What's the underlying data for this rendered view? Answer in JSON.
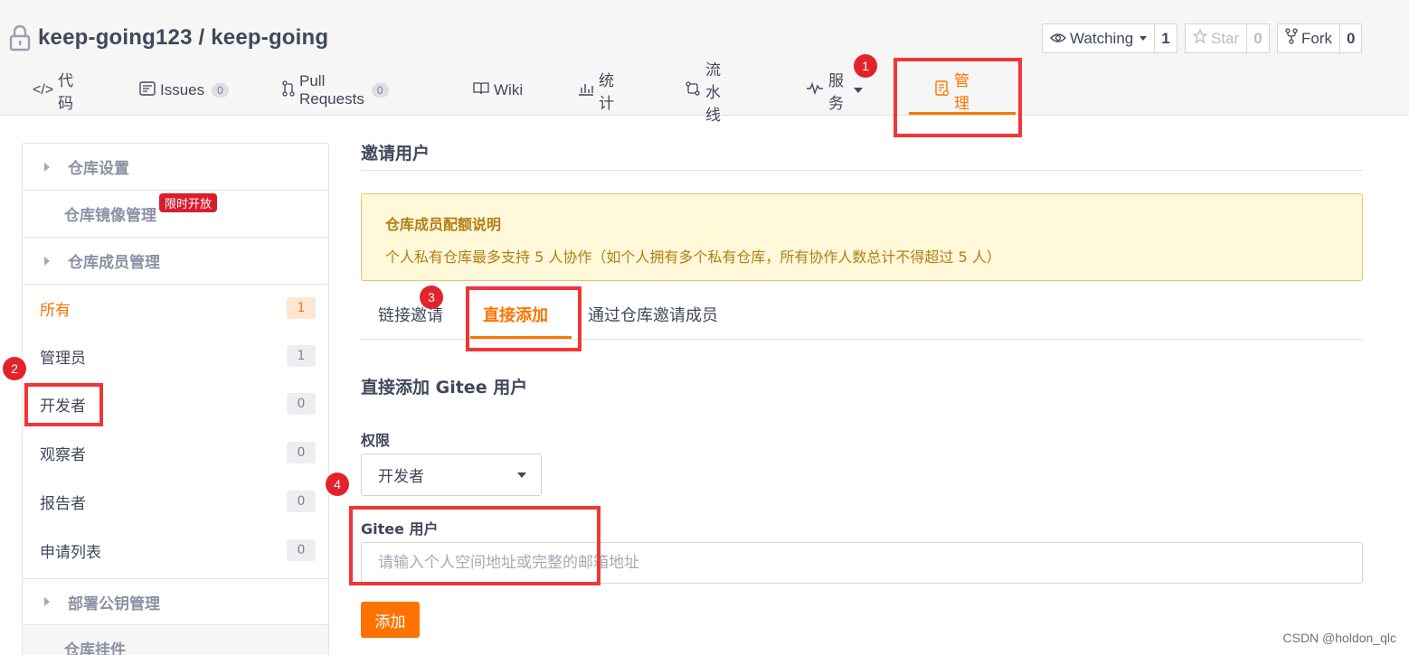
{
  "repo": {
    "title": "keep-going123 / keep-going"
  },
  "header_buttons": {
    "watching": {
      "label": "Watching",
      "count": "1"
    },
    "star": {
      "label": "Star",
      "count": "0"
    },
    "fork": {
      "label": "Fork",
      "count": "0"
    }
  },
  "tabs": [
    {
      "label": "代码"
    },
    {
      "label": "Issues",
      "badge": "0"
    },
    {
      "label": "Pull Requests",
      "badge": "0"
    },
    {
      "label": "Wiki"
    },
    {
      "label": "统计"
    },
    {
      "label": "流水线"
    },
    {
      "label": "服务"
    },
    {
      "label": "管理"
    }
  ],
  "markers": [
    "1",
    "2",
    "3",
    "4"
  ],
  "sidebar": {
    "sections": {
      "repo_settings": "仓库设置",
      "mirror": "仓库镜像管理",
      "mirror_tag": "限时开放",
      "members": "仓库成员管理",
      "deploy_keys": "部署公钥管理",
      "plugins": "仓库挂件"
    },
    "items": [
      {
        "label": "所有",
        "count": "1"
      },
      {
        "label": "管理员",
        "count": "1"
      },
      {
        "label": "开发者",
        "count": "0"
      },
      {
        "label": "观察者",
        "count": "0"
      },
      {
        "label": "报告者",
        "count": "0"
      },
      {
        "label": "申请列表",
        "count": "0"
      }
    ]
  },
  "main": {
    "title": "邀请用户",
    "notice": {
      "title": "仓库成员配额说明",
      "desc": "个人私有仓库最多支持 5 人协作（如个人拥有多个私有仓库，所有协作人数总计不得超过 5 人）"
    },
    "sub_tabs": [
      "链接邀请",
      "直接添加",
      "通过仓库邀请成员"
    ],
    "section_title": "直接添加 Gitee 用户",
    "permission_label": "权限",
    "permission_value": "开发者",
    "user_label": "Gitee 用户",
    "user_placeholder": "请输入个人空间地址或完整的邮箱地址",
    "add_button": "添加"
  },
  "watermark": "CSDN @holdon_qlc",
  "colors": {
    "accent": "#fe7300",
    "annotation": "#f03636",
    "notice_bg": "#fff8d9"
  }
}
